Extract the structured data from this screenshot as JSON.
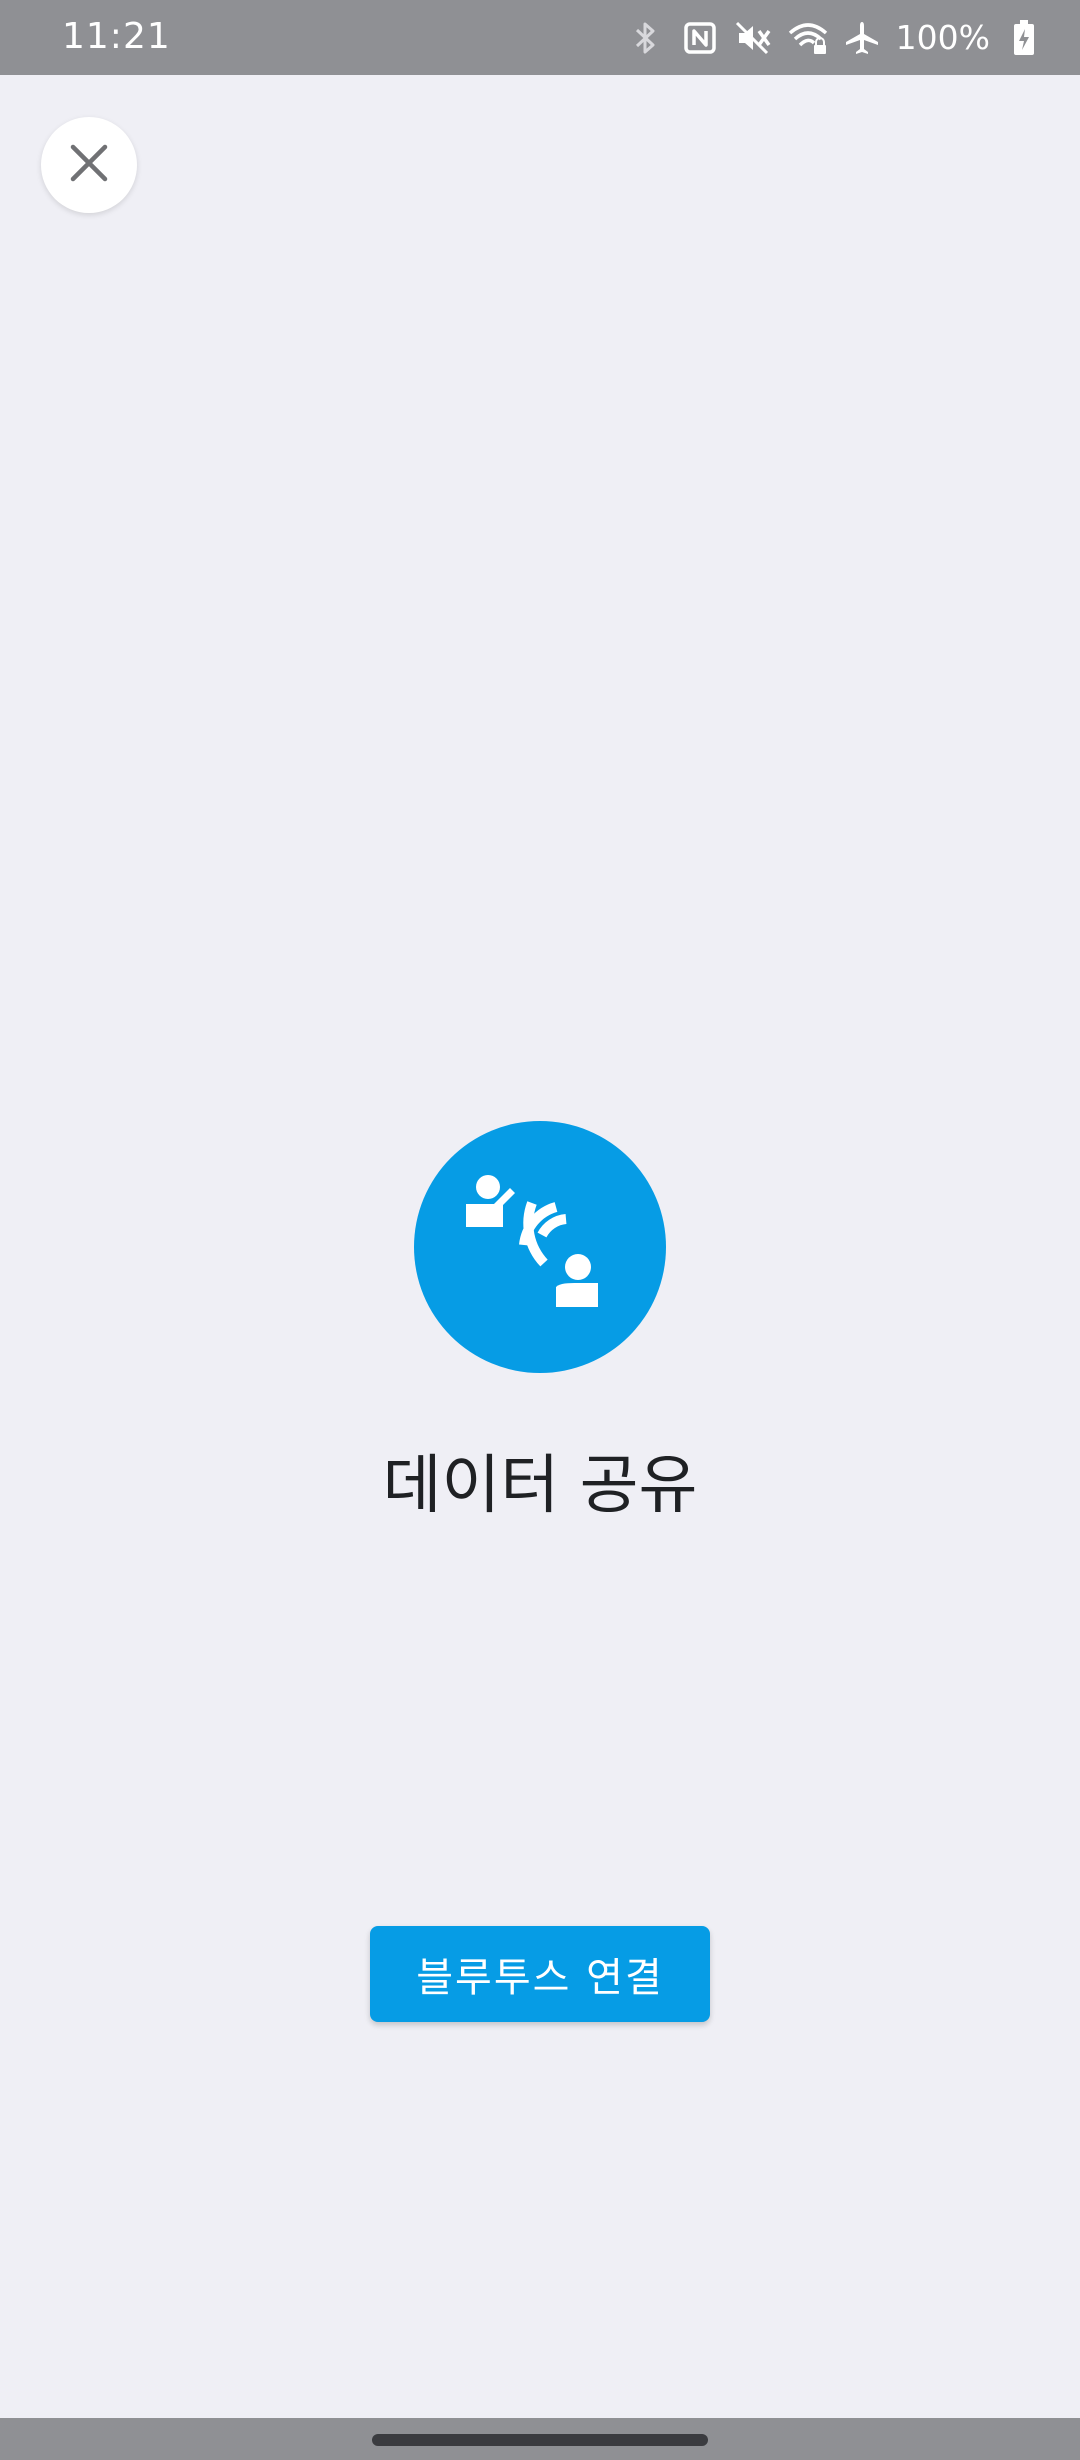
{
  "status_bar": {
    "time": "11:21",
    "battery": "100%",
    "icons": [
      "bluetooth-icon",
      "nfc-icon",
      "vibrate-mute-icon",
      "wifi-lock-icon",
      "airplane-icon",
      "battery-charging-icon"
    ]
  },
  "colors": {
    "accent": "#069ce5",
    "background": "#efeff5",
    "system_bar": "#8f9094"
  },
  "header": {
    "close_icon": "close-icon"
  },
  "main": {
    "hero_icon": "data-sharing-icon",
    "title": "데이터 공유",
    "connect_button_label": "블루투스 연결"
  }
}
